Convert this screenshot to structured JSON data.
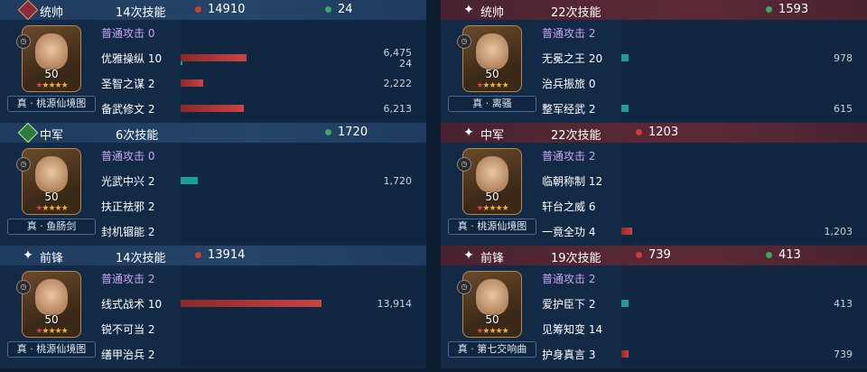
{
  "colors": {
    "damage_dot": "#d23b3b",
    "heal_dot": "#3aa860",
    "damage_bar": "#c84444",
    "heal_bar": "#1f9a9a"
  },
  "left": [
    {
      "position": "统帅",
      "badge_icon": "commander-badge-icon",
      "skill_count": "14次技能",
      "damage": "14910",
      "heal": "24",
      "level": "50",
      "set": "真 · 桃源仙境图",
      "rows": [
        {
          "name": "普通攻击",
          "count": "0",
          "normal": true,
          "damage": "",
          "heal": "",
          "damage_pct": 0,
          "heal_pct": 0
        },
        {
          "name": "优雅操纵",
          "count": "10",
          "damage": "6,475",
          "heal": "24",
          "damage_pct": 0.47,
          "heal_pct": 0.01
        },
        {
          "name": "圣智之谋",
          "count": "2",
          "damage": "2,222",
          "heal": "",
          "damage_pct": 0.16,
          "heal_pct": 0
        },
        {
          "name": "备武修文",
          "count": "2",
          "damage": "6,213",
          "heal": "",
          "damage_pct": 0.45,
          "heal_pct": 0
        }
      ]
    },
    {
      "position": "中军",
      "badge_icon": "green-heart-badge-icon",
      "skill_count": "6次技能",
      "damage": "",
      "heal": "1720",
      "level": "50",
      "set": "真 · 鱼肠剑",
      "rows": [
        {
          "name": "普通攻击",
          "count": "0",
          "normal": true,
          "damage": "",
          "heal": "",
          "damage_pct": 0,
          "heal_pct": 0
        },
        {
          "name": "光武中兴",
          "count": "2",
          "damage": "",
          "heal": "1,720",
          "damage_pct": 0,
          "heal_pct": 0.12
        },
        {
          "name": "扶正祛邪",
          "count": "2",
          "damage": "",
          "heal": "",
          "damage_pct": 0,
          "heal_pct": 0
        },
        {
          "name": "封机锢能",
          "count": "2",
          "damage": "",
          "heal": "",
          "damage_pct": 0,
          "heal_pct": 0
        }
      ]
    },
    {
      "position": "前锋",
      "badge_icon": "sparkle-badge-icon",
      "skill_count": "14次技能",
      "damage": "13914",
      "heal": "",
      "level": "50",
      "set": "真 · 桃源仙境图",
      "rows": [
        {
          "name": "普通攻击",
          "count": "2",
          "normal": true,
          "damage": "",
          "heal": "",
          "damage_pct": 0,
          "heal_pct": 0
        },
        {
          "name": "线式战术",
          "count": "10",
          "damage": "13,914",
          "heal": "",
          "damage_pct": 1.0,
          "heal_pct": 0
        },
        {
          "name": "锐不可当",
          "count": "2",
          "damage": "",
          "heal": "",
          "damage_pct": 0,
          "heal_pct": 0
        },
        {
          "name": "缮甲治兵",
          "count": "2",
          "damage": "",
          "heal": "",
          "damage_pct": 0,
          "heal_pct": 0
        }
      ]
    }
  ],
  "right": [
    {
      "position": "统帅",
      "badge_icon": "sparkle-badge-icon",
      "skill_count": "22次技能",
      "damage": "",
      "heal": "1593",
      "level": "50",
      "set": "真 · 离骚",
      "rows": [
        {
          "name": "普通攻击",
          "count": "2",
          "normal": true,
          "damage": "",
          "heal": "",
          "damage_pct": 0,
          "heal_pct": 0
        },
        {
          "name": "无冕之王",
          "count": "20",
          "damage": "",
          "heal": "978",
          "damage_pct": 0,
          "heal_pct": 0.05
        },
        {
          "name": "治兵振旅",
          "count": "0",
          "damage": "",
          "heal": "",
          "damage_pct": 0,
          "heal_pct": 0
        },
        {
          "name": "整军经武",
          "count": "2",
          "damage": "",
          "heal": "615",
          "damage_pct": 0,
          "heal_pct": 0.03
        }
      ]
    },
    {
      "position": "中军",
      "badge_icon": "sparkle-badge-icon",
      "skill_count": "22次技能",
      "damage": "1203",
      "heal": "",
      "level": "50",
      "set": "真 · 桃源仙境图",
      "rows": [
        {
          "name": "普通攻击",
          "count": "2",
          "normal": true,
          "damage": "",
          "heal": "",
          "damage_pct": 0,
          "heal_pct": 0
        },
        {
          "name": "临朝称制",
          "count": "12",
          "damage": "",
          "heal": "",
          "damage_pct": 0,
          "heal_pct": 0
        },
        {
          "name": "轩台之威",
          "count": "6",
          "damage": "",
          "heal": "",
          "damage_pct": 0,
          "heal_pct": 0
        },
        {
          "name": "一竟全功",
          "count": "4",
          "damage": "1,203",
          "heal": "",
          "damage_pct": 0.08,
          "heal_pct": 0
        }
      ]
    },
    {
      "position": "前锋",
      "badge_icon": "sparkle-badge-icon",
      "skill_count": "19次技能",
      "damage": "739",
      "heal": "413",
      "level": "50",
      "set": "真 · 第七交响曲",
      "rows": [
        {
          "name": "普通攻击",
          "count": "2",
          "normal": true,
          "damage": "",
          "heal": "",
          "damage_pct": 0,
          "heal_pct": 0
        },
        {
          "name": "爱护臣下",
          "count": "2",
          "damage": "",
          "heal": "413",
          "damage_pct": 0,
          "heal_pct": 0.02
        },
        {
          "name": "见筹知变",
          "count": "14",
          "damage": "",
          "heal": "",
          "damage_pct": 0,
          "heal_pct": 0
        },
        {
          "name": "护身真言",
          "count": "3",
          "damage": "739",
          "heal": "",
          "damage_pct": 0.05,
          "heal_pct": 0
        }
      ]
    }
  ]
}
